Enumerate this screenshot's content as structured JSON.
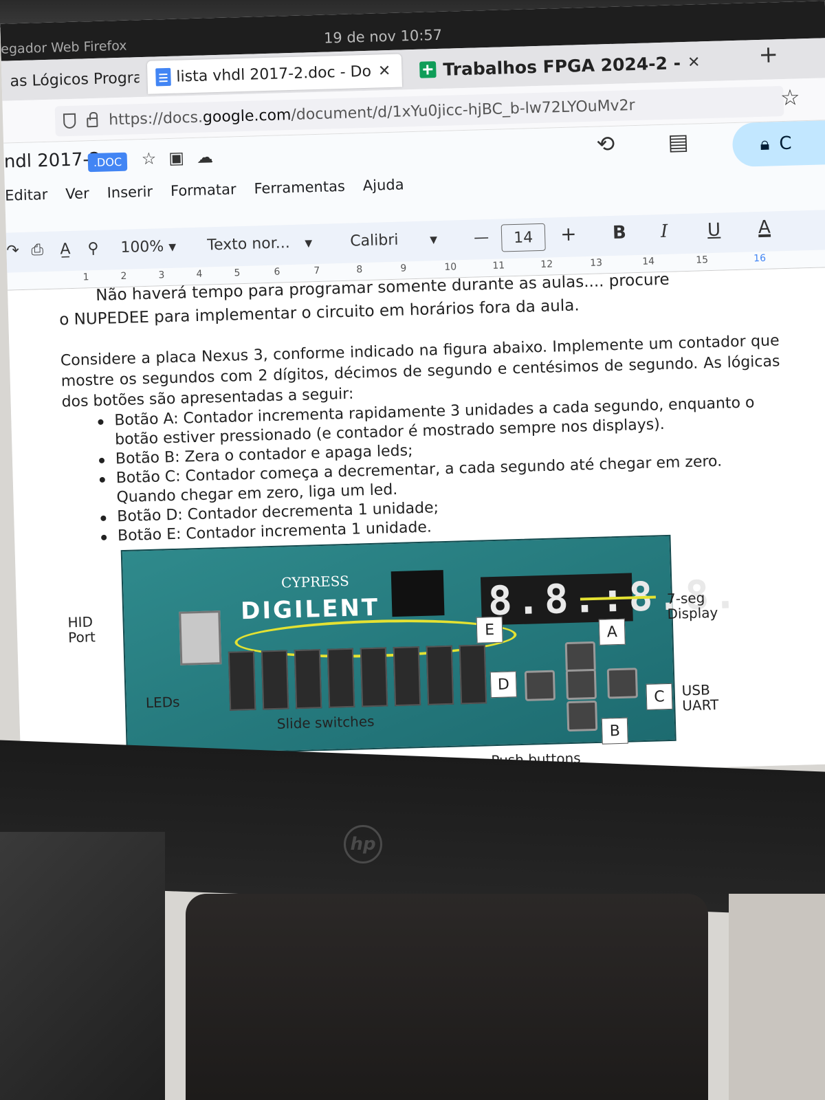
{
  "os": {
    "app_name": "egador Web Firefox",
    "clock": "19 de nov  10:57"
  },
  "browser": {
    "tabs": [
      {
        "label": "as Lógicos Progra",
        "active": false
      },
      {
        "label": "lista vhdl 2017-2.doc - Do",
        "active": true
      },
      {
        "label": "Trabalhos FPGA 2024-2 -",
        "active": false
      }
    ],
    "new_tab": "+",
    "url_prefix": "https://docs.",
    "url_host": "google.com",
    "url_path": "/document/d/1xYu0jicc-hjBC_b-lw72LYOuMv2r"
  },
  "docs": {
    "title": "ndl 2017-2",
    "badge": ".DOC",
    "menu": [
      "Editar",
      "Ver",
      "Inserir",
      "Formatar",
      "Ferramentas",
      "Ajuda"
    ],
    "share_label": "C",
    "toolbar": {
      "zoom": "100%",
      "style": "Texto nor...",
      "font": "Calibri",
      "minus": "—",
      "font_size": "14",
      "plus": "+",
      "bold": "B",
      "italic": "I",
      "underline": "U",
      "text_color": "A"
    },
    "ruler": [
      "1",
      "2",
      "3",
      "4",
      "5",
      "6",
      "7",
      "8",
      "9",
      "10",
      "11",
      "12",
      "13",
      "14",
      "15",
      "16"
    ]
  },
  "document": {
    "intro_line1": "Não haverá tempo para programar somente durante as aulas.... procure",
    "intro_line2": "o NUPEDEE para implementar o circuito em horários fora da aula.",
    "main_paragraph": "Considere a placa Nexus 3, conforme indicado na figura abaixo. Implemente um contador que mostre os segundos com 2 dígitos, décimos de segundo e centésimos de segundo. As lógicas dos botões são apresentadas a seguir:",
    "bullets": [
      "Botão A: Contador incrementa rapidamente 3 unidades a cada segundo, enquanto o botão estiver pressionado (e contador é mostrado sempre nos displays).",
      "Botão B: Zera o contador e apaga leds;",
      "Botão C: Contador começa a decrementar, a cada segundo até chegar em zero. Quando chegar em zero, liga um led.",
      "Botão D: Contador decrementa 1 unidade;",
      "Botão E: Contador incrementa 1 unidade."
    ]
  },
  "figure": {
    "board_brand": "DIGILENT",
    "chip_brand": "CYPRESS",
    "seven_seg_text": "8.8.:8.8.",
    "labels": {
      "hid_port": "HID\nPort",
      "leds": "LEDs",
      "slide_switches": "Slide switches",
      "push_buttons": "Push buttons",
      "seven_seg": "7-seg\nDisplay",
      "usb_uart": "USB\nUART"
    },
    "button_letters": [
      "A",
      "B",
      "C",
      "D",
      "E"
    ],
    "accent_color": "#e4e232"
  }
}
